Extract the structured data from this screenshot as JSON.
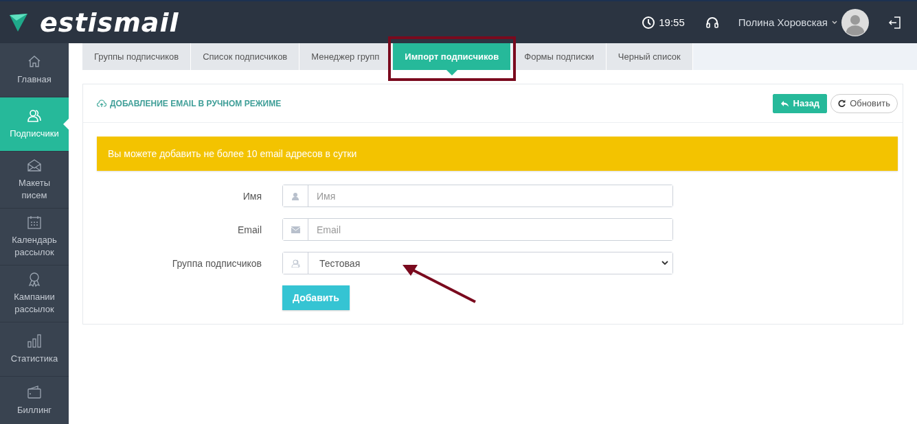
{
  "header": {
    "logo": "estismail",
    "time": "19:55",
    "user_name": "Полина Хоровская"
  },
  "sidebar": {
    "items": [
      {
        "label": "Главная",
        "selected": false
      },
      {
        "label": "Подписчики",
        "selected": true
      },
      {
        "label": "Макеты писем",
        "selected": false
      },
      {
        "label": "Календарь рассылок",
        "selected": false
      },
      {
        "label": "Кампании рассылок",
        "selected": false
      },
      {
        "label": "Статистика",
        "selected": false
      },
      {
        "label": "Биллинг",
        "selected": false
      }
    ]
  },
  "tabs": [
    {
      "label": "Группы подписчиков",
      "selected": false
    },
    {
      "label": "Список подписчиков",
      "selected": false
    },
    {
      "label": "Менеджер групп",
      "selected": false
    },
    {
      "label": "Импорт подписчиков",
      "selected": true
    },
    {
      "label": "Формы подписки",
      "selected": false
    },
    {
      "label": "Черный список",
      "selected": false
    }
  ],
  "panel": {
    "title": "ДОБАВЛЕНИЕ EMAIL В РУЧНОМ РЕЖИМЕ",
    "buttons": [
      {
        "label": "Назад",
        "kind": "primary"
      },
      {
        "label": "Обновить",
        "kind": "outline"
      }
    ],
    "alert": "Вы можете добавить не более 10 email адресов в сутки",
    "fields": [
      {
        "label": "Имя",
        "kind": "text",
        "placeholder": "Имя"
      },
      {
        "label": "Email",
        "kind": "email",
        "placeholder": "Email"
      },
      {
        "label": "Группа подписчиков",
        "kind": "select",
        "value": "Тестовая"
      }
    ],
    "submit": "Добавить"
  },
  "annotations": {
    "frame": true,
    "arrow": true
  }
}
